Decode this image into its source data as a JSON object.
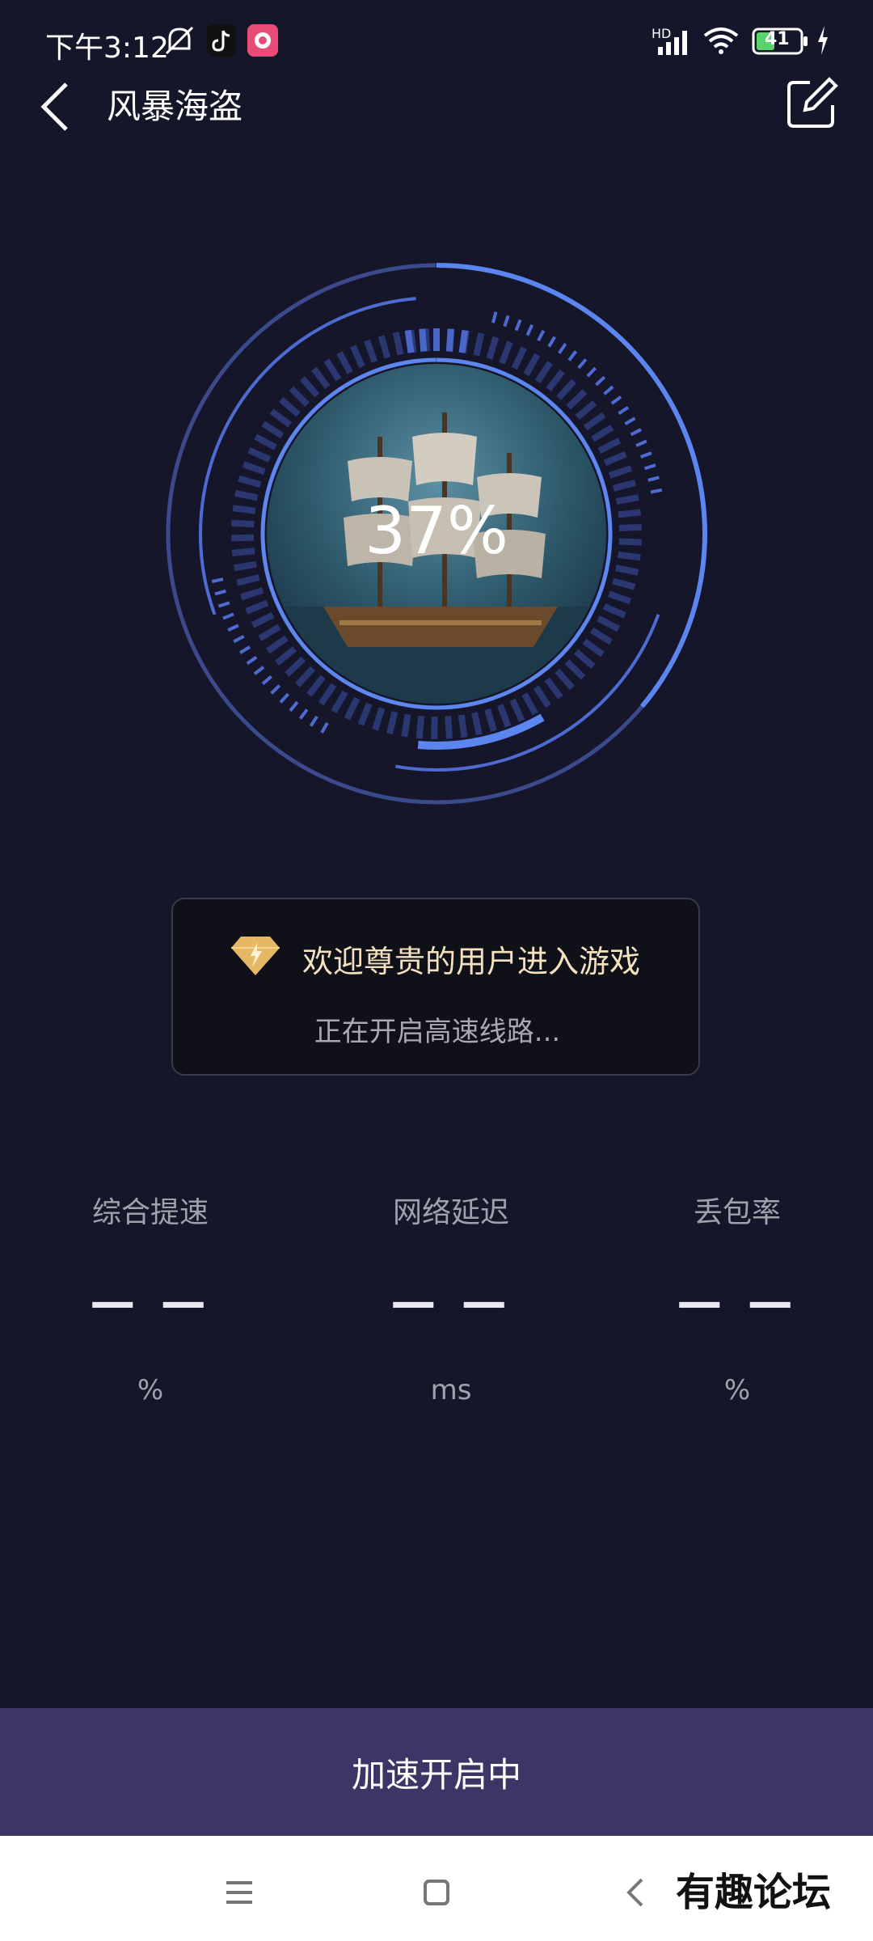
{
  "status_bar": {
    "time": "下午3:12",
    "signal_label": "HD",
    "battery_level": "41",
    "icons": [
      "mute-icon",
      "tiktok-icon",
      "app-icon",
      "signal-icon",
      "wifi-icon",
      "battery-icon",
      "charging-icon"
    ]
  },
  "header": {
    "title": "风暴海盗",
    "back_icon": "chevron-left-icon",
    "edit_icon": "edit-icon"
  },
  "progress": {
    "percent_text": "37%",
    "value": 0.37
  },
  "welcome": {
    "title": "欢迎尊贵的用户进入游戏",
    "subtitle": "正在开启高速线路...",
    "icon": "diamond-icon"
  },
  "stats": [
    {
      "label": "综合提速",
      "value": "— —",
      "unit": "%"
    },
    {
      "label": "网络延迟",
      "value": "— —",
      "unit": "ms"
    },
    {
      "label": "丢包率",
      "value": "— —",
      "unit": "%"
    }
  ],
  "action": {
    "label": "加速开启中"
  },
  "nav": {
    "icons": [
      "menu-icon",
      "home-icon",
      "back-icon"
    ]
  },
  "watermark": "有趣论坛",
  "colors": {
    "background": "#15162a",
    "accent": "#5b86f0",
    "button": "#3c3667",
    "card_title": "#f4e1bf"
  }
}
